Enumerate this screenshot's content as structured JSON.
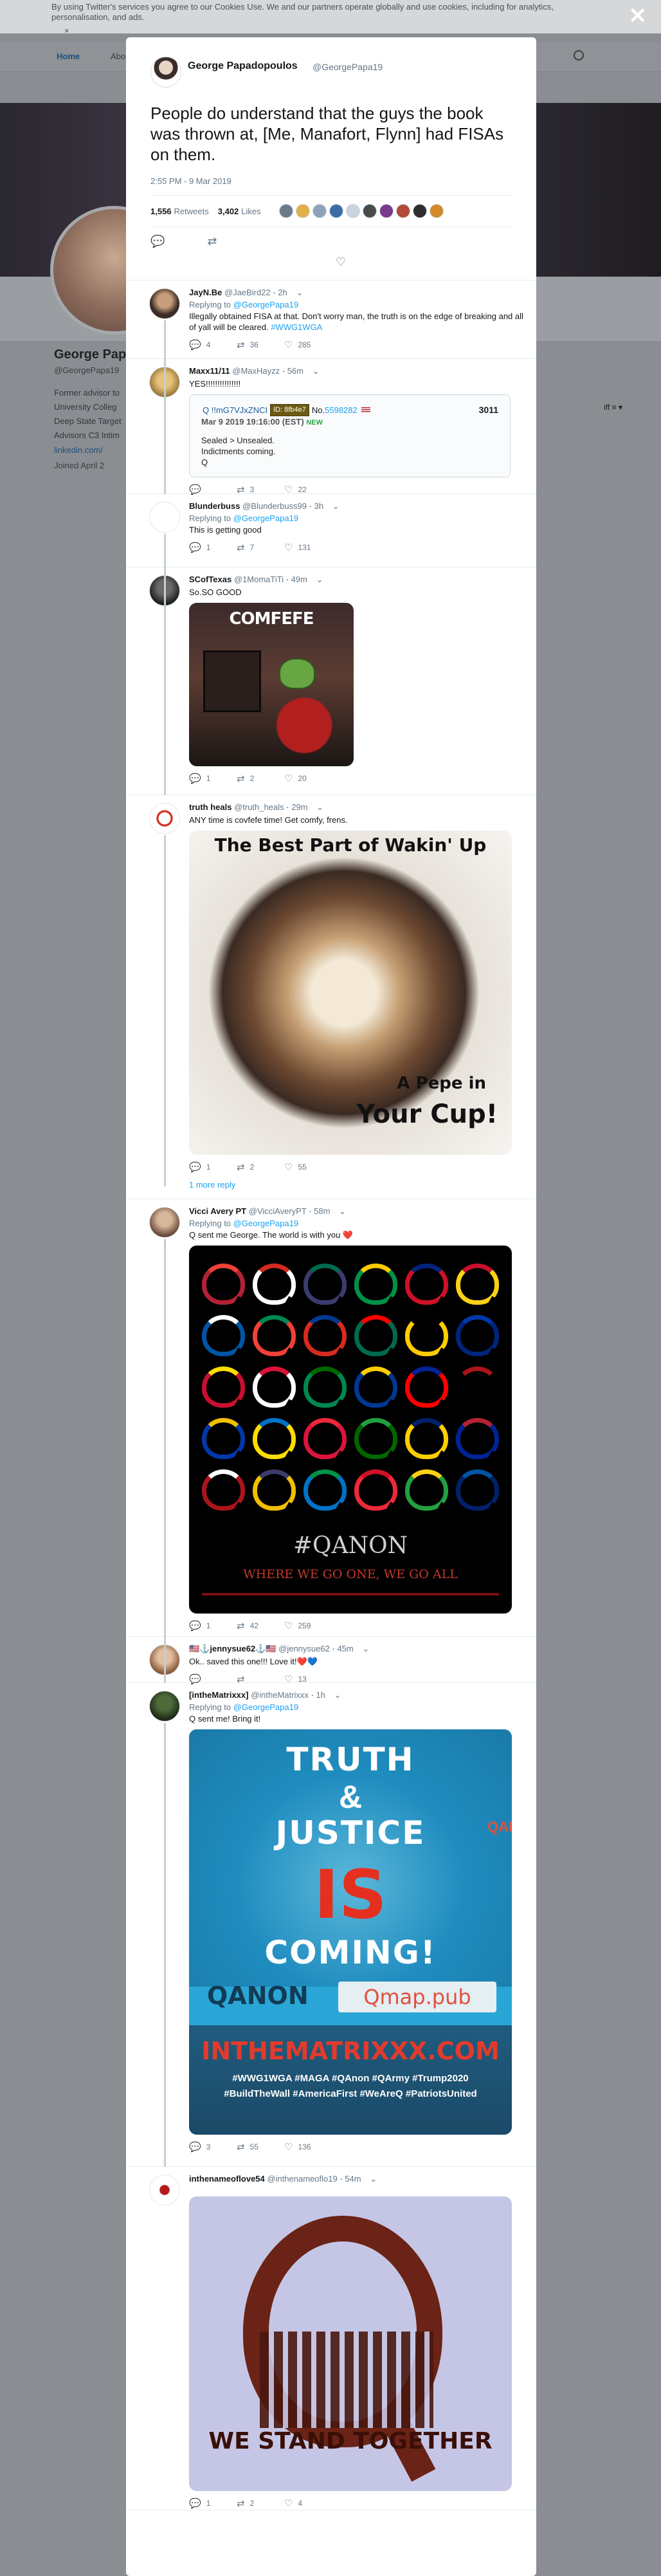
{
  "background": {
    "cookie_text": "By using Twitter's services you agree to our Cookies Use. We and our partners operate globally and use cookies, including for analytics, personalisation, and ads.",
    "cookie_close": "×",
    "nav_home": "Home",
    "nav_about": "Abo",
    "profile_name": "George Pap",
    "profile_handle": "@GeorgePapa19",
    "profile_bio": [
      "Former advisor to",
      "University Colleg",
      "Deep State Target",
      "Advisors C3 Intim"
    ],
    "profile_link": "linkedin.com/",
    "profile_joined": "Joined April 2",
    "header_follow": "iff ≡ ▾",
    "overlay_close": "✕"
  },
  "main_tweet": {
    "name": "George Papadopoulos",
    "handle": "@GeorgePapa19",
    "text": "People do understand that the guys the book was thrown at, [Me, Manafort, Flynn] had FISAs on them.",
    "timestamp": "2:55 PM - 9 Mar 2019",
    "retweets": "1,556",
    "retweets_label": "Retweets",
    "likes": "3,402",
    "likes_label": "Likes",
    "liker_colors": [
      "#6d7a8a",
      "#e2b04a",
      "#8fa3b8",
      "#3b6ea5",
      "#c9d4dd",
      "#4a4a4a",
      "#7a3b8a",
      "#b34a3a",
      "#2e2e2e",
      "#d28a2a"
    ]
  },
  "replies": [
    {
      "name": "JayN.Be",
      "handle": "@JaeBird22",
      "time": "2h",
      "replying": "Replying to",
      "replying_to": "@GeorgePapa19",
      "text": "Illegally obtained FISA at that. Don't worry man, the truth is on the edge of breaking and all of yall will be cleared.",
      "hashtag": "#WWG1WGA",
      "replies": "4",
      "retweets": "36",
      "likes": "285"
    },
    {
      "name": "Maxx11/11",
      "handle": "@MaxHayzz",
      "time": "56m",
      "text": "YES!!!!!!!!!!!!!!!",
      "replies": "",
      "retweets": "3",
      "likes": "22",
      "quote": {
        "qid": "Q !!mG7VJxZNCI",
        "badge": "ID: 8fb4e7",
        "no": "No.",
        "num_link": "5598282",
        "post_num": "3011",
        "date": "Mar 9 2019 19:16:00 (EST)",
        "new": "NEW",
        "line1": "Sealed > Unsealed.",
        "line2": "Indictments coming.",
        "line3": "Q"
      }
    },
    {
      "name": "Blunderbuss",
      "handle": "@Blunderbuss99",
      "time": "3h",
      "replying": "Replying to",
      "replying_to": "@GeorgePapa19",
      "text": "This is getting good",
      "replies": "1",
      "retweets": "7",
      "likes": "131"
    },
    {
      "name": "SCofTexas",
      "handle": "@1MomaTiTi",
      "time": "49m",
      "text": "So.SO GOOD",
      "image_title": "COMFEFE",
      "replies": "1",
      "retweets": "2",
      "likes": "20"
    },
    {
      "name": "truth heals",
      "handle": "@truth_heals",
      "time": "29m",
      "text": "ANY time is covfefe time! Get comfy, frens.",
      "image_top": "The Best Part of Wakin' Up",
      "image_bottom1": "A Pepe in",
      "image_bottom2": "Your Cup!",
      "replies": "1",
      "retweets": "2",
      "likes": "55"
    },
    {
      "more": "1 more reply"
    },
    {
      "name": "Vicci Avery PT",
      "handle": "@VicciAveryPT",
      "time": "58m",
      "replying": "Replying to",
      "replying_to": "@GeorgePapa19",
      "text": "Q sent me George. The world is with you ❤️",
      "image_hashtag": "#QANON",
      "image_motto": "WHERE WE GO ONE, WE GO ALL",
      "replies": "1",
      "retweets": "42",
      "likes": "259"
    },
    {
      "name": "🇺🇸⚓jennysue62⚓🇺🇸",
      "handle": "@jennysue62",
      "time": "45m",
      "text": "Ok.. saved this one!!! Love it!❤️💙",
      "replies": "",
      "retweets": "",
      "likes": "13"
    },
    {
      "name": "[intheMatrixxx]",
      "handle": "@intheMatrixxx",
      "time": "1h",
      "replying": "Replying to",
      "replying_to": "@GeorgePapa19",
      "text": "Q sent me! Bring it!",
      "image_lines": [
        "TRUTH",
        "&",
        "JUSTICE",
        "IS",
        "COMING!"
      ],
      "image_qanon": "QANON",
      "image_pill": "Qmap.pub",
      "image_side": "QARMY",
      "image_site": "INTHEMATRIXXX.COM",
      "image_hash1": "#WWG1WGA #MAGA #QAnon #QArmy #Trump2020",
      "image_hash2": "#BuildTheWall #AmericaFirst #WeAreQ #PatriotsUnited",
      "replies": "3",
      "retweets": "55",
      "likes": "136"
    },
    {
      "name": "inthenameoflove54",
      "handle": "@inthenameoflo19",
      "time": "54m",
      "image_caption": "WE STAND TOGETHER",
      "replies": "1",
      "retweets": "2",
      "likes": "4"
    }
  ],
  "icons": {
    "reply": "💬",
    "retweet": "⇄",
    "like": "♡",
    "chevron": "⌄"
  },
  "qanon_colors": [
    "#b22234",
    "#ffffff",
    "#3c3b6e",
    "#009246",
    "#ce1126",
    "#fcd116",
    "#0055a4",
    "#ef4135",
    "#d52b1e",
    "#006a4e",
    "#ffcc00",
    "#00247d",
    "#c8102e",
    "#ffffff",
    "#008751",
    "#003893",
    "#ff0000",
    "#000000",
    "#0038a8",
    "#fedd00",
    "#dc143c",
    "#006600",
    "#ffce00",
    "#002395",
    "#aa151b",
    "#f1bf00",
    "#0072c6",
    "#ed2939",
    "#239f40",
    "#012169"
  ]
}
